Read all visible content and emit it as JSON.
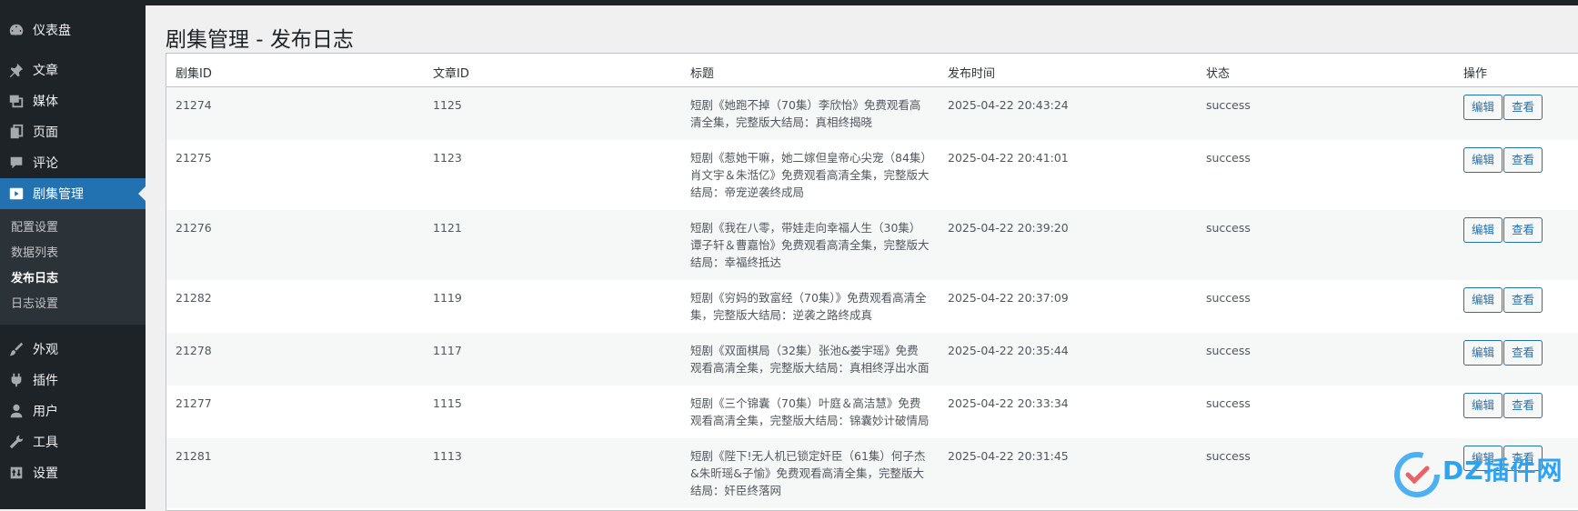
{
  "sidebar": {
    "items": [
      {
        "label": "仪表盘",
        "icon": "dashboard-icon"
      },
      {
        "label": "文章",
        "icon": "pin-icon"
      },
      {
        "label": "媒体",
        "icon": "media-icon"
      },
      {
        "label": "页面",
        "icon": "page-icon"
      },
      {
        "label": "评论",
        "icon": "comment-icon"
      },
      {
        "label": "剧集管理",
        "icon": "video-play-icon",
        "active": true
      },
      {
        "label": "外观",
        "icon": "brush-icon"
      },
      {
        "label": "插件",
        "icon": "plugin-icon"
      },
      {
        "label": "用户",
        "icon": "user-icon"
      },
      {
        "label": "工具",
        "icon": "wrench-icon"
      },
      {
        "label": "设置",
        "icon": "settings-icon"
      }
    ],
    "submenu": [
      {
        "label": "配置设置"
      },
      {
        "label": "数据列表"
      },
      {
        "label": "发布日志",
        "current": true
      },
      {
        "label": "日志设置"
      }
    ]
  },
  "page": {
    "title": "剧集管理 - 发布日志"
  },
  "table": {
    "columns": [
      "剧集ID",
      "文章ID",
      "标题",
      "发布时间",
      "状态",
      "操作"
    ],
    "edit_label": "编辑",
    "view_label": "查看",
    "rows": [
      {
        "drama_id": "21274",
        "post_id": "1125",
        "title": "短剧《她跑不掉（70集）李欣怡》免费观看高清全集，完整版大结局：真相终揭晓",
        "time": "2025-04-22 20:43:24",
        "status": "success"
      },
      {
        "drama_id": "21275",
        "post_id": "1123",
        "title": "短剧《惹她干嘛，她二嫁但皇帝心尖宠（84集）肖文宇＆朱湉亿》免费观看高清全集，完整版大结局：帝宠逆袭终成局",
        "time": "2025-04-22 20:41:01",
        "status": "success"
      },
      {
        "drama_id": "21276",
        "post_id": "1121",
        "title": "短剧《我在八零，带娃走向幸福人生（30集）谭子轩＆曹嘉怡》免费观看高清全集，完整版大结局：幸福终抵达",
        "time": "2025-04-22 20:39:20",
        "status": "success"
      },
      {
        "drama_id": "21282",
        "post_id": "1119",
        "title": "短剧《穷妈的致富经（70集）》免费观看高清全集，完整版大结局：逆袭之路终成真",
        "time": "2025-04-22 20:37:09",
        "status": "success"
      },
      {
        "drama_id": "21278",
        "post_id": "1117",
        "title": "短剧《双面棋局（32集）张池&娄宇瑶》免费观看高清全集，完整版大结局：真相终浮出水面",
        "time": "2025-04-22 20:35:44",
        "status": "success"
      },
      {
        "drama_id": "21277",
        "post_id": "1115",
        "title": "短剧《三个锦囊（70集）叶庭＆高洁慧》免费观看高清全集，完整版大结局：锦囊妙计破情局",
        "time": "2025-04-22 20:33:34",
        "status": "success"
      },
      {
        "drama_id": "21281",
        "post_id": "1113",
        "title": "短剧《陛下!无人机已锁定奸臣（61集）何子杰&朱昕瑶&子愉》免费观看高清全集，完整版大结局：奸臣终落网",
        "time": "2025-04-22 20:31:45",
        "status": "success"
      }
    ]
  },
  "watermark": {
    "text": "DZ插件网"
  },
  "colors": {
    "sidebar_bg": "#1d2327",
    "accent": "#2271b1",
    "submenu_bg": "#2c3338",
    "page_bg": "#f0f0f1"
  }
}
